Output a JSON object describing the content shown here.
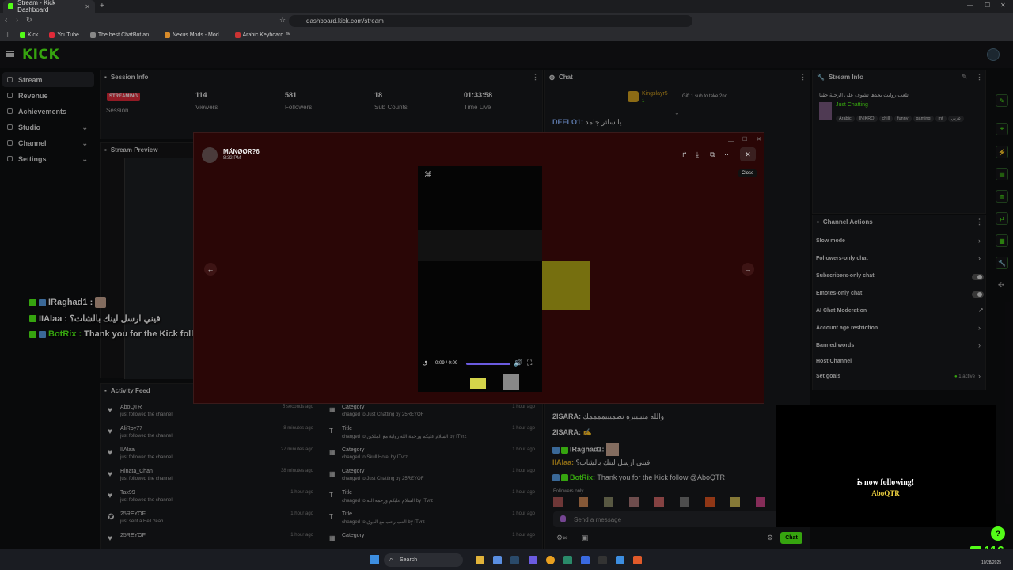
{
  "browser": {
    "tab_title": "Stream - Kick Dashboard",
    "url": "dashboard.kick.com/stream",
    "bookmarks": [
      "Kick",
      "YouTube",
      "The best ChatBot an...",
      "Nexus Mods - Mod...",
      "Arabic Keyboard ™..."
    ]
  },
  "app": {
    "logo": "KICK"
  },
  "sidebar": {
    "items": [
      {
        "label": "Stream",
        "active": true
      },
      {
        "label": "Revenue"
      },
      {
        "label": "Achievements"
      },
      {
        "label": "Studio",
        "expandable": true
      },
      {
        "label": "Channel",
        "expandable": true
      },
      {
        "label": "Settings",
        "expandable": true
      }
    ]
  },
  "session": {
    "title": "Session Info",
    "live_badge": "STREAMING",
    "session_label": "Session",
    "stats": [
      {
        "value": "114",
        "label": "Viewers"
      },
      {
        "value": "581",
        "label": "Followers"
      },
      {
        "value": "18",
        "label": "Sub Counts"
      },
      {
        "value": "01:33:58",
        "label": "Time Live"
      }
    ]
  },
  "preview": {
    "title": "Stream Preview"
  },
  "overlay_chat": [
    {
      "user": "IRaghad1 :",
      "text": ""
    },
    {
      "user": "IIAlaa :",
      "text": "فيني ارسل لينك بالشات؟"
    },
    {
      "user": "BotRix :",
      "text": "Thank you for the Kick follow @AboQTR"
    }
  ],
  "activity": {
    "title": "Activity Feed",
    "left": [
      {
        "name": "AboQTR",
        "sub": "just followed the channel",
        "time": "5 seconds ago"
      },
      {
        "name": "AliRoy77",
        "sub": "just followed the channel",
        "time": "8 minutes ago"
      },
      {
        "name": "IIAlaa",
        "sub": "just followed the channel",
        "time": "27 minutes ago"
      },
      {
        "name": "Hinata_Chan",
        "sub": "just followed the channel",
        "time": "38 minutes ago"
      },
      {
        "name": "Tax99",
        "sub": "just followed the channel",
        "time": "1 hour ago"
      },
      {
        "name": "25REYOF",
        "sub": "just sent a Hell Yeah",
        "time": "1 hour ago"
      },
      {
        "name": "25REYOF",
        "sub": "",
        "time": "1 hour ago"
      }
    ],
    "right": [
      {
        "title": "Category",
        "sub": "changed to Just Chatting by 25REYOF",
        "time": "1 hour ago"
      },
      {
        "title": "Title",
        "sub": "changed to السلام عليكم ورحمة الله رواية مع الملكين by ITvrz",
        "time": "1 hour ago"
      },
      {
        "title": "Category",
        "sub": "changed to Skull Hotel by ITvrz",
        "time": "1 hour ago"
      },
      {
        "title": "Category",
        "sub": "changed to Just Chatting by 25REYOF",
        "time": "1 hour ago"
      },
      {
        "title": "Title",
        "sub": "changed to السلام عليكم ورحمة الله by ITvrz",
        "time": "1 hour ago"
      },
      {
        "title": "Title",
        "sub": "changed to العب رحب مع الدوق by ITvrz",
        "time": "1 hour ago"
      },
      {
        "title": "Category",
        "sub": "",
        "time": "1 hour ago"
      }
    ]
  },
  "chat": {
    "title": "Chat",
    "pinned_user": "Kingslayr5",
    "pinned_level": "1",
    "pinned_text": "Gift 1 sub to take 2nd",
    "messages": [
      {
        "user": "DEELO1:",
        "text": "يا ساتر جامد"
      },
      {
        "user": "2ISARA:",
        "text": "والله متييييره تصميييممممك"
      },
      {
        "user": "2ISARA:",
        "text": ""
      },
      {
        "user": "IRaghad1:",
        "text": ""
      },
      {
        "user": "IIAlaa:",
        "text": "فيني ارسل لينك بالشات؟"
      },
      {
        "user": "BotRix:",
        "text": "Thank you for the Kick follow @AboQTR"
      }
    ],
    "followers_only": "Followers only",
    "placeholder": "Send a message",
    "send_label": "Chat"
  },
  "stream_info": {
    "title": "Stream Info",
    "stream_title": "تلعب روايت بحدها تشوف على الرحلة حقنا",
    "category": "Just Chatting",
    "tags": [
      "Arabic",
      "INIKRO",
      "chill",
      "funny",
      "gaming",
      "mt",
      "عربي"
    ]
  },
  "channel_actions": {
    "title": "Channel Actions",
    "items": [
      {
        "label": "Slow mode",
        "kind": "chevron"
      },
      {
        "label": "Followers-only chat",
        "kind": "chevron"
      },
      {
        "label": "Subscribers-only chat",
        "kind": "toggle"
      },
      {
        "label": "Emotes-only chat",
        "kind": "toggle"
      },
      {
        "label": "AI Chat Moderation",
        "kind": "link"
      },
      {
        "label": "Account age restriction",
        "kind": "chevron"
      },
      {
        "label": "Banned words",
        "kind": "chevron"
      },
      {
        "label": "Host Channel",
        "kind": "none"
      },
      {
        "label": "Set goals",
        "kind": "chevron",
        "badge": "1 active"
      }
    ]
  },
  "modal": {
    "user": "MÄNØØR?6",
    "time": "8:32 PM",
    "video_time": "0:09 / 0:09",
    "close_tooltip": "Close"
  },
  "alert": {
    "line1": "is now following!",
    "line2": "AboQTR"
  },
  "viewer_overlay": "116",
  "taskbar": {
    "search": "Search",
    "date": "10/28/2025"
  },
  "colors": {
    "accent": "#53fc18",
    "live": "#e02a39",
    "bg": "#0f1012",
    "panel": "#18191c",
    "modal": "#2a0606"
  }
}
